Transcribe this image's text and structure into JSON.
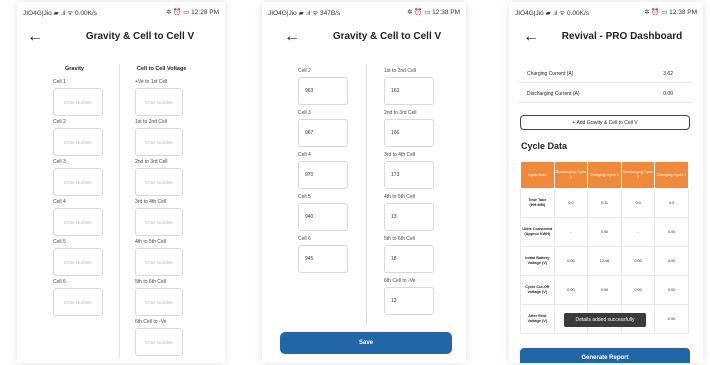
{
  "screen1": {
    "status_left": "JIO4G|Jio ▰ .ıl ᯤ 0.00K/s",
    "status_right": "✲ ⏰ ▭ 12:28 PM",
    "title": "Gravity & Cell to Cell V",
    "col_gravity": "Gravity",
    "col_voltage": "Cell to Cell Voltage",
    "gravity_cells": [
      "Cell 1",
      "Cell 2",
      "Cell 3",
      "Cell 4",
      "Cell 5",
      "Cell 6"
    ],
    "voltage_labels": [
      "+Ve to 1st Cell",
      "1st to 2nd Cell",
      "2nd to 3rd Cell",
      "3rd to 4th Cell",
      "4th to 5th Cell",
      "5th to 6th Cell",
      "6th Cell to -Ve"
    ],
    "placeholder": "Enter Number"
  },
  "screen2": {
    "status_left": "JIO4G|Jio ▰ .ıl ᯤ 347B/s",
    "status_right": "✲ ⏰ ▭ 12:38 PM",
    "title": "Gravity & Cell to Cell V",
    "gravity_rows": [
      {
        "label": "Cell 2",
        "value": "963"
      },
      {
        "label": "Cell 3",
        "value": "967"
      },
      {
        "label": "Cell 4",
        "value": "970"
      },
      {
        "label": "Cell 5",
        "value": "940"
      },
      {
        "label": "Cell 6",
        "value": "945"
      }
    ],
    "voltage_rows": [
      {
        "label": "1st to 2nd Cell",
        "value": "163"
      },
      {
        "label": "2nd to 3rd Cell",
        "value": "166"
      },
      {
        "label": "3rd to 4th Cell",
        "value": "173"
      },
      {
        "label": "4th to 5th Cell",
        "value": "13"
      },
      {
        "label": "5th to 6th Cell",
        "value": "18"
      },
      {
        "label": "6th Cell to -Ve",
        "value": "13"
      }
    ],
    "save_label": "Save"
  },
  "screen3": {
    "status_left": "JIO4G|Jio ▰ .ıl ᯤ 0.00K/s",
    "status_right": "✲ ⏰ ▭ 12:38 PM",
    "title": "Revival - PRO Dashboard",
    "charging_label": "Charging Current (A)",
    "charging_value": "3.62",
    "discharging_label": "Discharging Current (A)",
    "discharging_value": "0.00",
    "add_button": "+ Add Gravity & Cell to Cell V",
    "cycle_title": "Cycle Data",
    "table_headers": [
      "Cycle Data",
      "Discharging Cycle 1",
      "Charging Cycle 1",
      "Discharging Cycle 2",
      "Charging Cycle 2"
    ],
    "table_rows": [
      [
        "Time Take (HH:MM)",
        "0:0",
        "0:11",
        "0:0",
        "0:0"
      ],
      [
        "Units Consumed (Approx KWH)",
        "-",
        "0.00",
        "-",
        "0.00"
      ],
      [
        "Initial Battery Voltage (V)",
        "0.00",
        "12.46",
        "0.00",
        "0.00"
      ],
      [
        "Cycle Cut-Off Voltage (V)",
        "0.00",
        "0.00",
        "0.00",
        "0.00"
      ],
      [
        "After Rest Voltage (V)",
        "",
        "",
        "",
        "0.00"
      ]
    ],
    "toast": "Details added successfully",
    "generate_button": "Generate Report"
  },
  "colors": {
    "accent_blue": "#2266a8",
    "header_orange": "#f08a3a"
  }
}
